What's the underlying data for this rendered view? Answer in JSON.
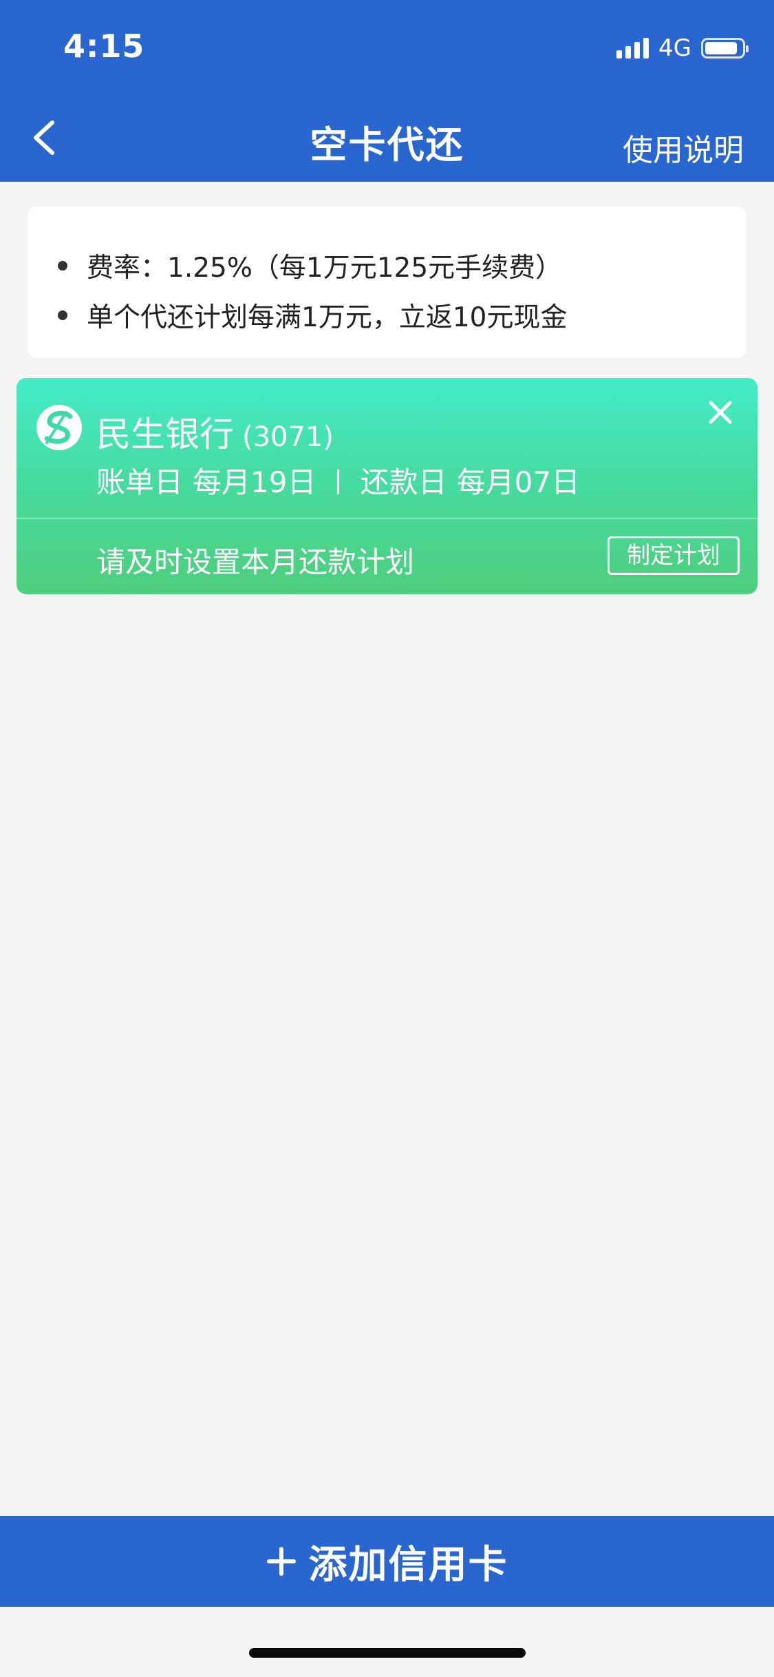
{
  "status_bar": {
    "time": "4:15",
    "network": "4G"
  },
  "header": {
    "title": "空卡代还",
    "help_link": "使用说明"
  },
  "info": {
    "items": [
      "费率：1.25%（每1万元125元手续费）",
      "单个代还计划每满1万元，立返10元现金"
    ]
  },
  "card": {
    "bank_name": "民生银行",
    "tail_number": "(3071)",
    "bill_day_label": "账单日",
    "bill_day_value": "每月19日",
    "separator": "|",
    "repay_day_label": "还款日",
    "repay_day_value": "每月07日",
    "reminder": "请及时设置本月还款计划",
    "plan_button": "制定计划"
  },
  "footer": {
    "add_card_label": "添加信用卡"
  },
  "colors": {
    "primary_blue": "#2a66cf",
    "card_green_top": "#43ecc7",
    "card_green_bottom": "#4ece7c",
    "background": "#f4f4f4"
  },
  "icons": {
    "back": "chevron-left-icon",
    "close": "close-icon",
    "bank_logo": "cmbc-logo",
    "add": "plus-icon"
  }
}
